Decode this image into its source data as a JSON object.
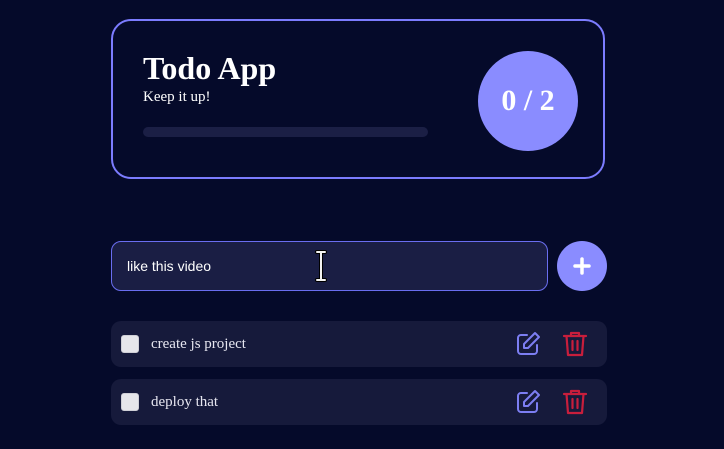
{
  "header": {
    "title": "Todo App",
    "subtitle": "Keep it up!",
    "progress_fraction": 0,
    "counter": "0 / 2"
  },
  "input": {
    "value": "like this video",
    "add_icon": "plus-icon"
  },
  "todos": [
    {
      "text": "create js project",
      "checked": false,
      "edit_icon": "edit-icon",
      "delete_icon": "trash-icon"
    },
    {
      "text": "deploy that",
      "checked": false,
      "edit_icon": "edit-icon",
      "delete_icon": "trash-icon"
    }
  ],
  "colors": {
    "background": "#050a2a",
    "accent": "#8a8cff",
    "edit": "#7c7ef2",
    "delete": "#c81e3c"
  }
}
